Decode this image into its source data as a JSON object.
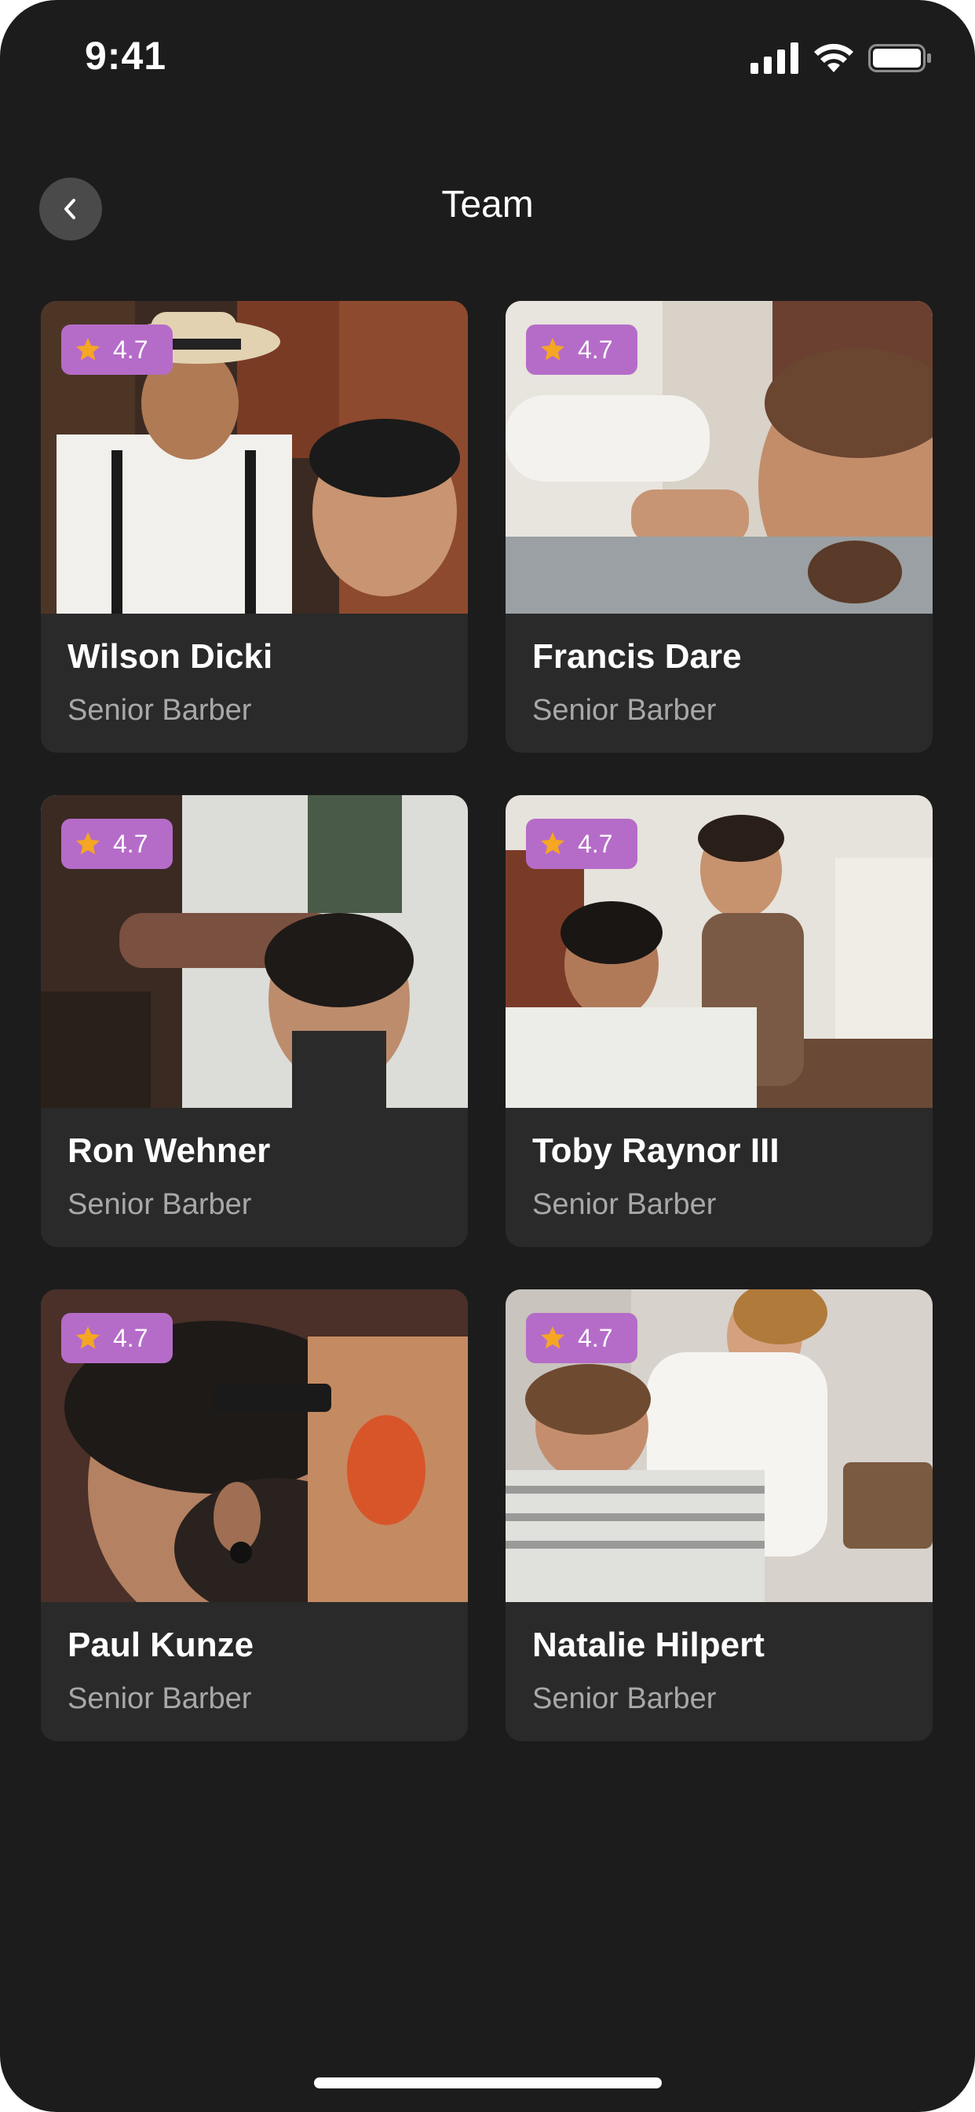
{
  "status_bar": {
    "time": "9:41",
    "icons": [
      "cellular-signal-icon",
      "wifi-icon",
      "battery-icon"
    ]
  },
  "header": {
    "title": "Team",
    "back_icon": "chevron-left-icon"
  },
  "colors": {
    "background": "#1c1c1c",
    "card": "#2a2a2a",
    "badge": "#b56cc8",
    "star": "#f5a623",
    "back_button": "#4a4a4a",
    "secondary_text": "#a8a8a8"
  },
  "team": [
    {
      "name": "Wilson Dicki",
      "role": "Senior Barber",
      "rating": "4.7"
    },
    {
      "name": "Francis Dare",
      "role": "Senior Barber",
      "rating": "4.7"
    },
    {
      "name": "Ron Wehner",
      "role": "Senior Barber",
      "rating": "4.7"
    },
    {
      "name": "Toby Raynor III",
      "role": "Senior Barber",
      "rating": "4.7"
    },
    {
      "name": "Paul Kunze",
      "role": "Senior Barber",
      "rating": "4.7"
    },
    {
      "name": "Natalie Hilpert",
      "role": "Senior Barber",
      "rating": "4.7"
    }
  ]
}
